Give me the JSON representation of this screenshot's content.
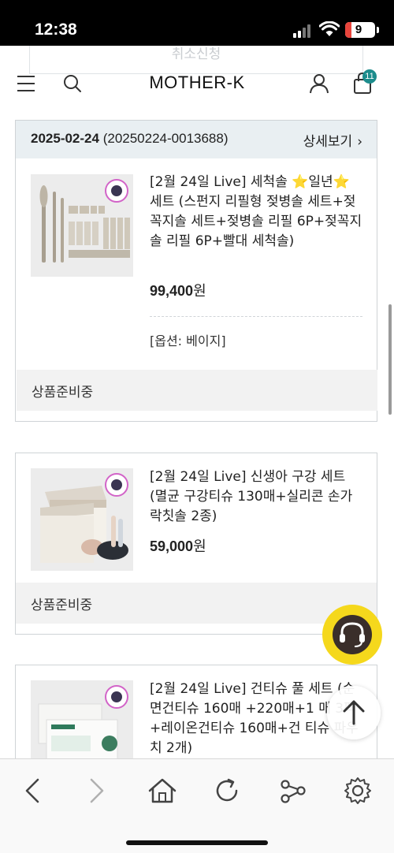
{
  "status_bar": {
    "time": "12:38",
    "battery": "9"
  },
  "ghost_button": {
    "label": "취소신청"
  },
  "header": {
    "logo": "MOTHER-K",
    "cart_count": "11"
  },
  "order": {
    "date": "2025-02-24",
    "number": "(20250224-0013688)",
    "detail_label": "상세보기"
  },
  "items": [
    {
      "name": "[2월 24일 Live] 세척솔 ⭐️일년⭐️ 세트 (스펀지 리필형 젖병솔 세트+젖꼭지솔 세트+젖병솔 리필 6P+젖꼭지솔 리필 6P+빨대 세척솔)",
      "price": "99,400",
      "price_unit": "원",
      "option": "[옵션: 베이지]",
      "status": "상품준비중"
    },
    {
      "name": "[2월 24일 Live] 신생아 구강 세트 (멸균 구강티슈 130매+실리콘 손가락칫솔 2종)",
      "price": "59,000",
      "price_unit": "원",
      "status": "상품준비중"
    },
    {
      "name": "[2월 24일 Live] 건티슈 풀 세트 (순면건티슈 160매 +220매+1 매 3팩+레이온건티슈 160매+건 티슈 파우치 2개)"
    }
  ],
  "bottom_nav": [
    "back-icon",
    "forward-icon",
    "home-icon",
    "reload-icon",
    "share-icon",
    "settings-icon"
  ],
  "colors": {
    "accent_teal": "#1c8c8c",
    "chat_yellow": "#f5d81c",
    "header_bg": "#e9eff2",
    "status_bg": "#f2f2f2"
  }
}
